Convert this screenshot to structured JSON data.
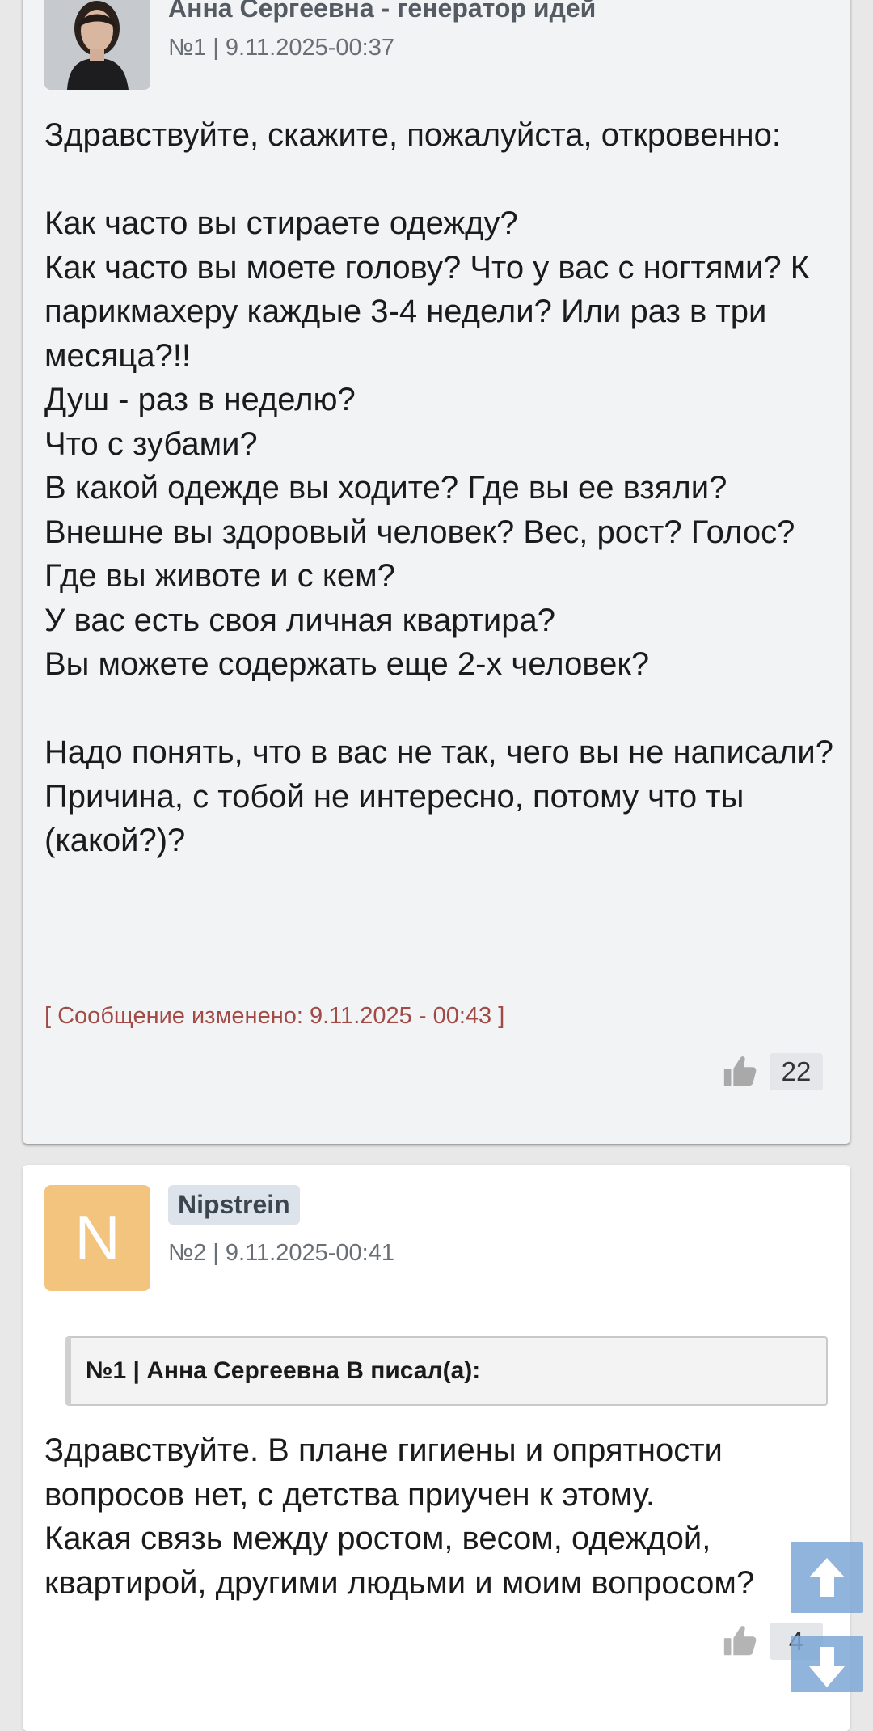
{
  "posts": [
    {
      "author": "Анна Сергеевна - генератор идей",
      "meta": "№1 | 9.11.2025-00:37",
      "body": "Здравствуйте, скажите, пожалуйста, откровенно:\n\nКак часто вы стираете одежду?\nКак часто вы моете голову? Что у вас с ногтями? К парикмахеру каждые 3-4 недели? Или раз в три месяца?!!\nДуш - раз в неделю?\nЧто с зубами?\nВ какой одежде вы ходите? Где вы ее взяли?\nВнешне вы здоровый человек? Вес, рост? Голос?\nГде вы животе и с кем?\nУ вас есть своя личная квартира?\nВы можете содержать еще 2-х человек?\n\nНадо понять, что в вас не так, чего вы не написали?\nПричина, с тобой не интересно, потому что ты (какой?)?",
      "edited": "[ Сообщение изменено: 9.11.2025 - 00:43 ]",
      "likes": "22"
    },
    {
      "author": "Nipstrein",
      "avatar_letter": "N",
      "meta": "№2 | 9.11.2025-00:41",
      "quote": "№1 | Анна Сергеевна В писал(а):",
      "body": "Здравствуйте. В плане гигиены и опрятности вопросов нет, с детства приучен к этому.\nКакая связь между ростом, весом, одеждой, квартирой, другими людьми и моим вопросом?",
      "likes": "4"
    }
  ],
  "icons": {
    "like": "thumbs-up-icon",
    "scroll_up": "arrow-up-icon",
    "scroll_down": "arrow-down-icon"
  },
  "colors": {
    "edited_text": "#a14a46",
    "avatar_n": "#f2c47e",
    "fab": "#7ca7d6"
  }
}
